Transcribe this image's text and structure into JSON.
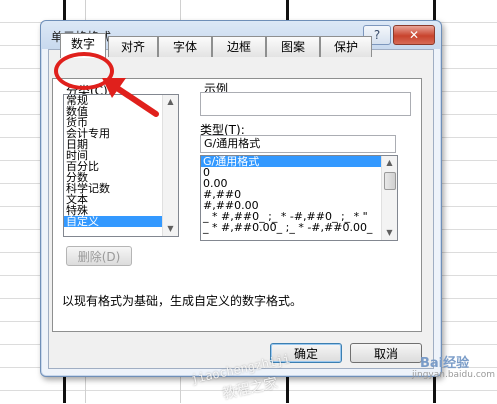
{
  "dialog": {
    "title": "单元格格式",
    "help_label": "?",
    "close_label": "✕"
  },
  "tabs": [
    {
      "label": "数字",
      "active": true
    },
    {
      "label": "对齐"
    },
    {
      "label": "字体"
    },
    {
      "label": "边框"
    },
    {
      "label": "图案"
    },
    {
      "label": "保护"
    }
  ],
  "category": {
    "label": "分类(C):",
    "items": [
      "常规",
      "数值",
      "货币",
      "会计专用",
      "日期",
      "时间",
      "百分比",
      "分数",
      "科学记数",
      "文本",
      "特殊",
      "自定义"
    ],
    "selected": "自定义"
  },
  "sample": {
    "label": "示例",
    "value": ""
  },
  "type": {
    "label": "类型(T):",
    "input_value": "G/通用格式",
    "items": [
      "G/通用格式",
      "0",
      "0.00",
      "#,##0",
      "#,##0.00",
      "_ * #,##0_ ;_ * -#,##0_ ;_ * \"",
      "_ * #,##0.00_ ;_ * -#,##0.00_"
    ],
    "selected": "G/通用格式"
  },
  "delete_button": "删除(D)",
  "description": "以现有格式为基础，生成自定义的数字格式。",
  "ok_button": "确定",
  "cancel_button": "取消",
  "watermarks": {
    "url_text": "jiaochengzhiji",
    "site_name": "教程之家",
    "logo_text": "Bai经验",
    "logo_url": "jingyan.baidu.com"
  },
  "colors": {
    "annotation": "#e0201c",
    "selection": "#3399ff"
  }
}
